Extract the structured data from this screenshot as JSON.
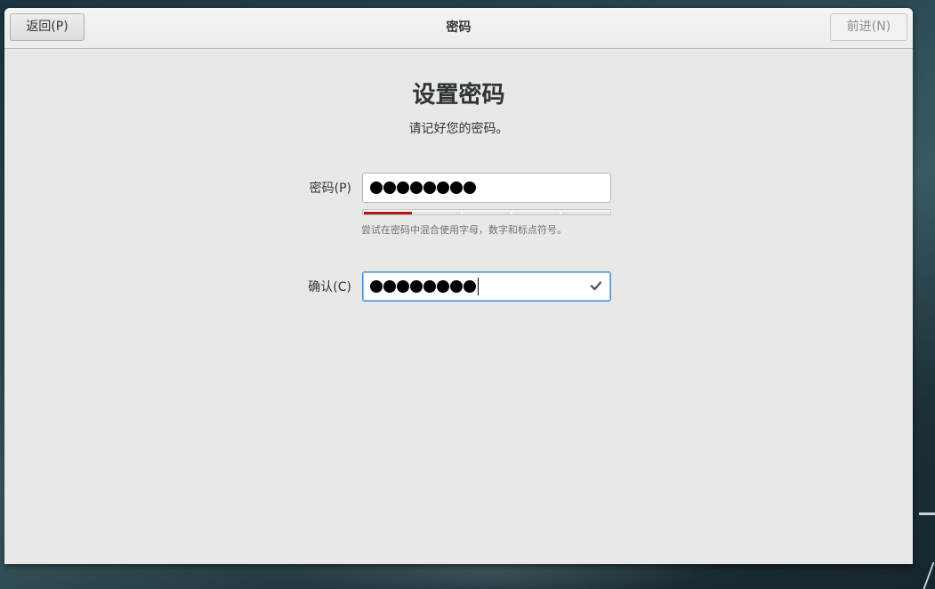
{
  "header": {
    "back_label": "返回(P)",
    "title": "密码",
    "next_label": "前进(N)"
  },
  "main": {
    "heading": "设置密码",
    "subtitle": "请记好您的密码。",
    "password": {
      "label": "密码(P)",
      "masked_length": 8,
      "strength_fraction": 0.2,
      "strength_segments": 5,
      "strength_color": "#b21818",
      "hint": "尝试在密码中混合使用字母，数字和标点符号。"
    },
    "confirm": {
      "label": "确认(C)",
      "masked_length": 8,
      "status_icon": "check-icon"
    }
  },
  "colors": {
    "focus_border": "#4a90d9",
    "strength_weak": "#b21818"
  }
}
